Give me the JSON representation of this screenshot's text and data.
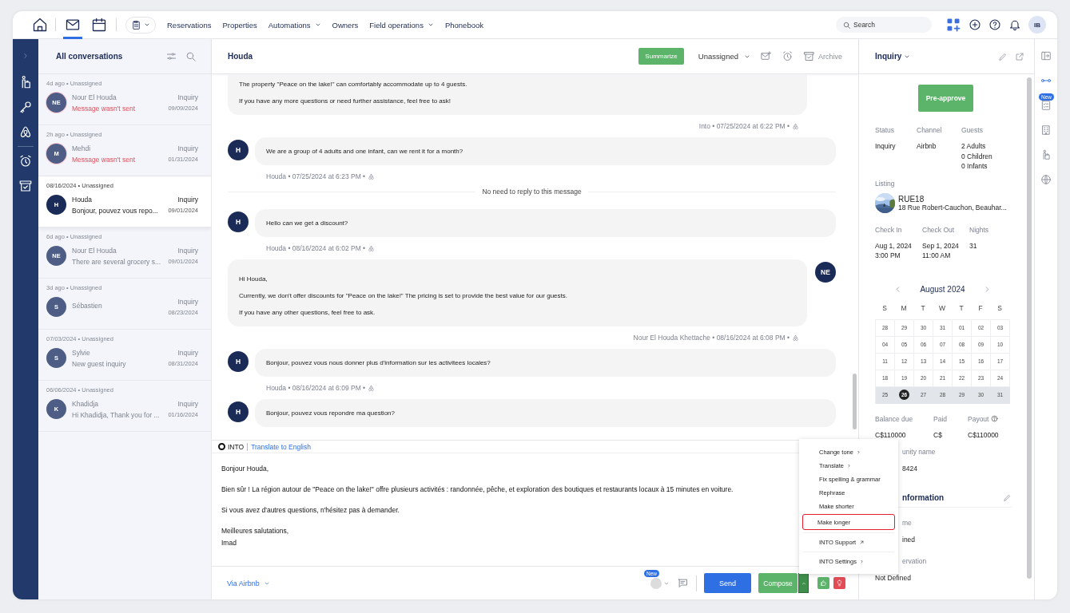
{
  "top_nav": {
    "icon_tabs": [
      {
        "kind": "mail",
        "selected": true
      },
      {
        "kind": "calendar",
        "selected": false
      }
    ],
    "links": [
      {
        "label": "Reservations",
        "dropdown": false
      },
      {
        "label": "Properties",
        "dropdown": false
      },
      {
        "label": "Automations",
        "dropdown": true
      },
      {
        "label": "Owners",
        "dropdown": false
      },
      {
        "label": "Field operations",
        "dropdown": true
      },
      {
        "label": "Phonebook",
        "dropdown": false
      }
    ],
    "search": {
      "placeholder": "Search"
    },
    "avatar": "IB"
  },
  "conversation_list": {
    "title": "All conversations",
    "items": [
      {
        "meta": "4d ago • Unassigned",
        "initials": "NE",
        "name": "Nour El Houda",
        "status": "Inquiry",
        "preview": "Message wasn't sent",
        "date": "09/09/2024",
        "failed": true,
        "selected": false
      },
      {
        "meta": "2h ago • Unassigned",
        "initials": "M",
        "name": "Mehdi",
        "status": "Inquiry",
        "preview": "Message wasn't sent",
        "date": "01/31/2024",
        "failed": true,
        "selected": false
      },
      {
        "meta": "08/16/2024 • Unassigned",
        "initials": "H",
        "name": "Houda",
        "status": "Inquiry",
        "preview": "Bonjour, pouvez vous repo...",
        "date": "09/01/2024",
        "failed": false,
        "selected": true
      },
      {
        "meta": "6d ago • Unassigned",
        "initials": "NE",
        "name": "Nour El Houda",
        "status": "Inquiry",
        "preview": "There are several grocery s...",
        "date": "09/01/2024",
        "failed": false,
        "selected": false
      },
      {
        "meta": "3d ago • Unassigned",
        "initials": "S",
        "name": "Sébastien",
        "status": "Inquiry",
        "date": "08/23/2024",
        "selected": false
      },
      {
        "meta": "07/03/2024 • Unassigned",
        "initials": "S",
        "name": "Sylvie",
        "status": "Inquiry",
        "preview": "New guest inquiry",
        "date": "08/31/2024",
        "failed": false,
        "selected": false
      },
      {
        "meta": "06/06/2024 • Unassigned",
        "initials": "K",
        "name": "Khadidja",
        "status": "Inquiry",
        "preview": "Hi Khadidja, Thank you for ...",
        "date": "01/16/2024",
        "failed": false,
        "selected": false
      }
    ]
  },
  "chat": {
    "title": "Houda",
    "summarize": "Summarize",
    "assignee": "Unassigned",
    "archive": "Archive",
    "messages": [
      {
        "kind": "outgoing",
        "paragraphs": [
          "The property \"Peace on the lake!\" can comfortably accommodate up to 4 guests.",
          "If you have any more questions or need further assistance, feel free to ask!"
        ],
        "meta": "Into • 07/25/2024 at 6:22 PM •"
      },
      {
        "kind": "incoming",
        "initials": "H",
        "paragraphs": [
          "We are a group of 4 adults and one infant, can we rent it for a month?"
        ],
        "meta": "Houda • 07/25/2024 at 6:23 PM •"
      },
      {
        "kind": "notice",
        "text": "No need to reply to this message"
      },
      {
        "kind": "incoming",
        "initials": "H",
        "paragraphs": [
          "Hello can we get a discount?"
        ],
        "meta": "Houda • 08/16/2024 at 6:02 PM •"
      },
      {
        "kind": "outgoing",
        "initials": "NE",
        "paragraphs": [
          "Hi Houda,",
          "Currently, we don't offer discounts for \"Peace on the lake!\" The pricing is set to provide the best value for our guests.",
          "If you have any other questions, feel free to ask."
        ],
        "meta": "Nour El Houda Khettache • 08/16/2024 at 6:08 PM •"
      },
      {
        "kind": "incoming",
        "initials": "H",
        "paragraphs": [
          "Bonjour, pouvez vous nous donner plus d'information sur les activitees locales?"
        ],
        "meta": "Houda • 08/16/2024 at 6:09 PM •"
      },
      {
        "kind": "incoming",
        "initials": "H",
        "paragraphs": [
          "Bonjour, pouvez vous repondre ma question?"
        ]
      }
    ],
    "composer": {
      "brand": "INTO",
      "translate": "Translate to English",
      "paragraphs": [
        "Bonjour Houda,",
        "Bien sûr ! La région autour de \"Peace on the lake!\" offre plusieurs activités : randonnée, pêche, et exploration des boutiques et restaurants locaux à 15 minutes en voiture.",
        "Si vous avez d'autres questions, n'hésitez pas à demander.",
        "Meilleures salutations,\nImad"
      ],
      "channel": "Via Airbnb",
      "new_badge": "New",
      "send": "Send",
      "compose": "Compose"
    }
  },
  "ai_menu": [
    {
      "label": "Change tone",
      "submenu": true,
      "external": false,
      "divider_before": false,
      "selected": false
    },
    {
      "label": "Translate",
      "submenu": true,
      "external": false,
      "divider_before": false,
      "selected": false
    },
    {
      "label": "Fix spelling & grammar",
      "submenu": false,
      "external": false,
      "divider_before": false,
      "selected": false
    },
    {
      "label": "Rephrase",
      "submenu": false,
      "external": false,
      "divider_before": false,
      "selected": false
    },
    {
      "label": "Make shorter",
      "submenu": false,
      "external": false,
      "divider_before": false,
      "selected": false
    },
    {
      "label": "Make longer",
      "submenu": false,
      "external": false,
      "divider_before": false,
      "selected": true
    },
    {
      "label": "INTO Support",
      "submenu": false,
      "external": true,
      "divider_before": true,
      "selected": false
    },
    {
      "label": "INTO Settings",
      "submenu": true,
      "external": false,
      "divider_before": true,
      "selected": false
    }
  ],
  "details_panel": {
    "title": "Inquiry",
    "pre_approve": "Pre-approve",
    "summary": [
      {
        "label": "Status",
        "values": [
          "Inquiry"
        ]
      },
      {
        "label": "Channel",
        "values": [
          "Airbnb"
        ]
      },
      {
        "label": "Guests",
        "values": [
          "2 Adults",
          "0 Children",
          "0 Infants"
        ]
      }
    ],
    "listing": {
      "label": "Listing",
      "name": "RUE18",
      "address": "18 Rue Robert-Cauchon, Beauhar..."
    },
    "stay": [
      {
        "label": "Check In",
        "values": [
          "Aug 1, 2024",
          "3:00 PM"
        ]
      },
      {
        "label": "Check Out",
        "values": [
          "Sep 1, 2024",
          "11:00 AM"
        ]
      },
      {
        "label": "Nights",
        "values": [
          "31"
        ]
      }
    ],
    "calendar": {
      "month": "August 2024",
      "weekdays": [
        "S",
        "M",
        "T",
        "W",
        "T",
        "F",
        "S"
      ],
      "days": [
        {
          "label": "28",
          "selected": false,
          "in_range": false
        },
        {
          "label": "29",
          "selected": false,
          "in_range": false
        },
        {
          "label": "30",
          "selected": false,
          "in_range": false
        },
        {
          "label": "31",
          "selected": false,
          "in_range": false
        },
        {
          "label": "01",
          "selected": false,
          "in_range": false
        },
        {
          "label": "02",
          "selected": false,
          "in_range": false
        },
        {
          "label": "03",
          "selected": false,
          "in_range": false
        },
        {
          "label": "04",
          "selected": false,
          "in_range": false
        },
        {
          "label": "05",
          "selected": false,
          "in_range": false
        },
        {
          "label": "06",
          "selected": false,
          "in_range": false
        },
        {
          "label": "07",
          "selected": false,
          "in_range": false
        },
        {
          "label": "08",
          "selected": false,
          "in_range": false
        },
        {
          "label": "09",
          "selected": false,
          "in_range": false
        },
        {
          "label": "10",
          "selected": false,
          "in_range": false
        },
        {
          "label": "11",
          "selected": false,
          "in_range": false
        },
        {
          "label": "12",
          "selected": false,
          "in_range": false
        },
        {
          "label": "13",
          "selected": false,
          "in_range": false
        },
        {
          "label": "14",
          "selected": false,
          "in_range": false
        },
        {
          "label": "15",
          "selected": false,
          "in_range": false
        },
        {
          "label": "16",
          "selected": false,
          "in_range": false
        },
        {
          "label": "17",
          "selected": false,
          "in_range": false
        },
        {
          "label": "18",
          "selected": false,
          "in_range": false
        },
        {
          "label": "19",
          "selected": false,
          "in_range": false
        },
        {
          "label": "20",
          "selected": false,
          "in_range": false
        },
        {
          "label": "21",
          "selected": false,
          "in_range": false
        },
        {
          "label": "22",
          "selected": false,
          "in_range": false
        },
        {
          "label": "23",
          "selected": false,
          "in_range": false
        },
        {
          "label": "24",
          "selected": false,
          "in_range": false
        },
        {
          "label": "25",
          "selected": false,
          "in_range": true
        },
        {
          "label": "26",
          "selected": true,
          "in_range": true
        },
        {
          "label": "27",
          "selected": false,
          "in_range": true
        },
        {
          "label": "28",
          "selected": false,
          "in_range": true
        },
        {
          "label": "29",
          "selected": false,
          "in_range": true
        },
        {
          "label": "30",
          "selected": false,
          "in_range": true
        },
        {
          "label": "31",
          "selected": false,
          "in_range": true
        }
      ]
    },
    "payments": [
      {
        "label": "Balance due",
        "value": "C$110000",
        "help": false
      },
      {
        "label": "Paid",
        "value": "C$",
        "help": false
      },
      {
        "label": "Payout",
        "value": "C$110000",
        "help": true
      }
    ],
    "partial_fields": [
      {
        "label": "unity name",
        "value": "8424"
      }
    ],
    "section": {
      "title": "nformation",
      "fields": [
        {
          "label": "me",
          "value": "ined",
          "clipped": true
        },
        {
          "label": "ervation",
          "value": "Not Defined",
          "clipped": false
        }
      ]
    }
  },
  "side_rail": {
    "badge": "New"
  }
}
